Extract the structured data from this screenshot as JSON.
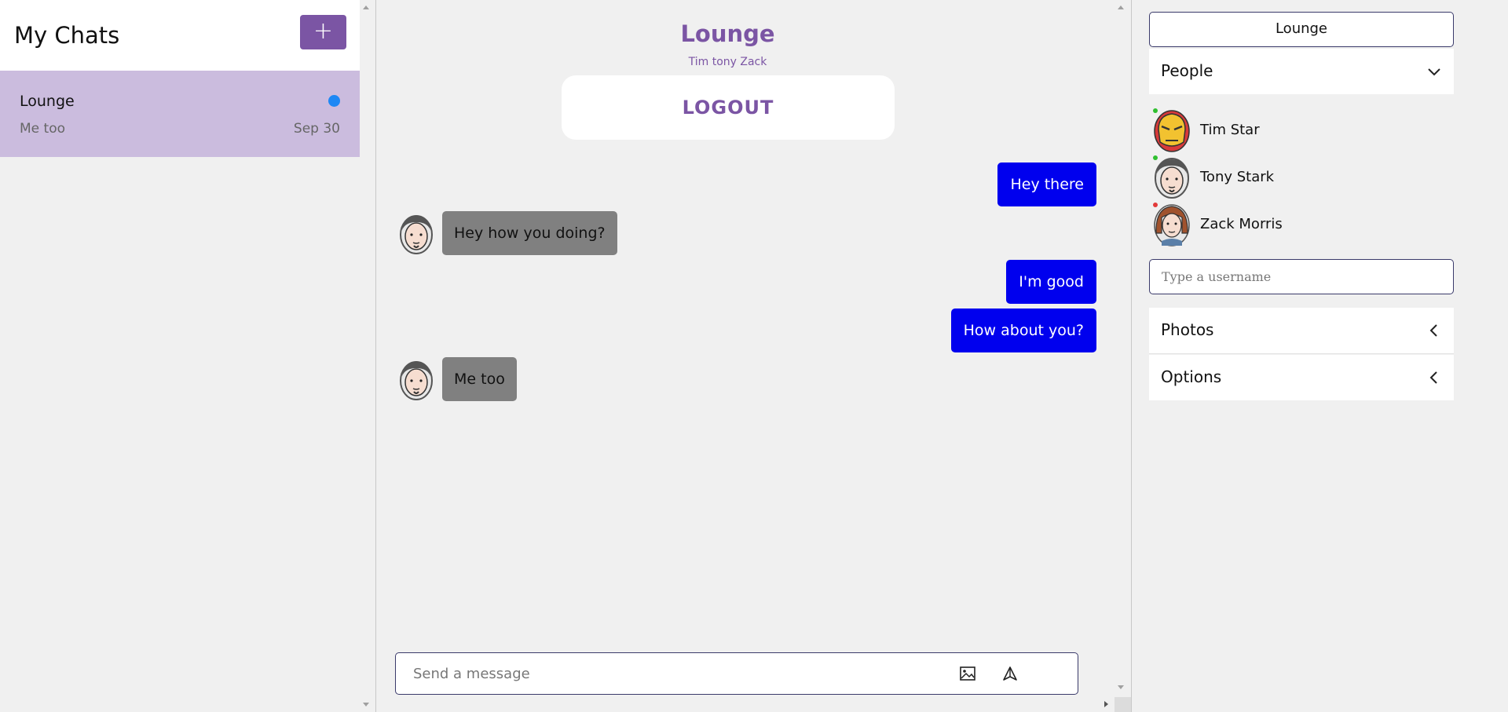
{
  "sidebar": {
    "title": "My Chats",
    "new_chat_label": "+",
    "chats": [
      {
        "name": "Lounge",
        "last_message": "Me too",
        "date": "Sep 30",
        "unread_color": "#1e88f5"
      }
    ]
  },
  "room": {
    "title": "Lounge",
    "members_line": "Tim tony Zack",
    "logout_label": "LOGOUT"
  },
  "messages": [
    {
      "text": "Hey there",
      "mine": true
    },
    {
      "text": "Hey how you doing?",
      "mine": false,
      "avatar": "tony-stark-avatar"
    },
    {
      "text": "I'm good",
      "mine": true
    },
    {
      "text": "How about you?",
      "mine": true
    },
    {
      "text": "Me too",
      "mine": false,
      "avatar": "tony-stark-avatar"
    }
  ],
  "composer": {
    "placeholder": "Send a message",
    "attach_icon": "image-icon",
    "send_icon": "send-icon"
  },
  "details": {
    "room_name": "Lounge",
    "people_label": "People",
    "people": [
      {
        "name": "Tim Star",
        "online": true,
        "status_color": "#2fbf2f",
        "avatar": "iron-man-avatar"
      },
      {
        "name": "Tony Stark",
        "online": true,
        "status_color": "#2fbf2f",
        "avatar": "tony-stark-avatar"
      },
      {
        "name": "Zack Morris",
        "online": false,
        "status_color": "#e23a3a",
        "avatar": "zack-morris-avatar"
      }
    ],
    "username_placeholder": "Type a username",
    "photos_label": "Photos",
    "options_label": "Options"
  },
  "colors": {
    "accent": "#7b55a4",
    "selected_chat": "#cbbcde",
    "my_bubble": "#0000ee",
    "their_bubble": "#808080"
  }
}
